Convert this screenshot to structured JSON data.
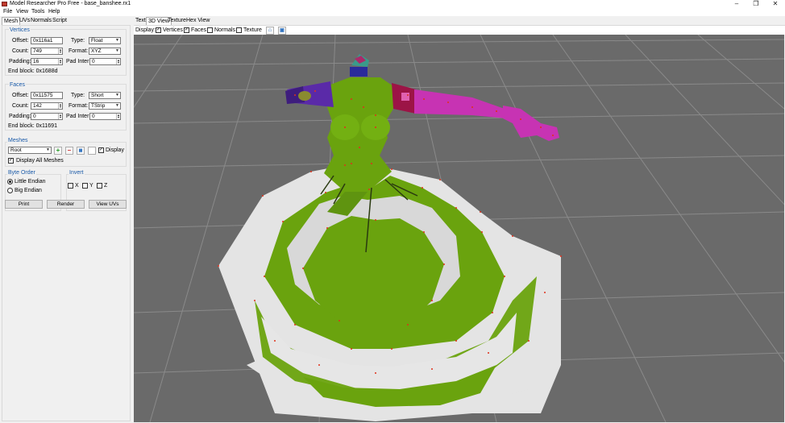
{
  "window": {
    "title": "Model Researcher Pro Free - base_banshee.rx1"
  },
  "menu": [
    "File",
    "View",
    "Tools",
    "Help"
  ],
  "left_tabs": [
    "Mesh",
    "UVs",
    "Normals",
    "Script"
  ],
  "vertices": {
    "title": "Vertices",
    "offset_label": "Offset:",
    "offset": "0x116a1",
    "type_label": "Type:",
    "type": "Float",
    "count_label": "Count:",
    "count": "749",
    "format_label": "Format:",
    "format": "XYZ",
    "padding_label": "Padding:",
    "padding": "16",
    "padinter_label": "Pad Inter:",
    "padinter": "0",
    "endblock": "End block: 0x1688d"
  },
  "faces": {
    "title": "Faces",
    "offset_label": "Offset:",
    "offset": "0x11575",
    "type_label": "Type:",
    "type": "Short",
    "count_label": "Count:",
    "count": "142",
    "format_label": "Format:",
    "format": "TStrip",
    "padding_label": "Padding:",
    "padding": "0",
    "padinter_label": "Pad Inter:",
    "padinter": "0",
    "endblock": "End block: 0x11691"
  },
  "meshes": {
    "title": "Meshes",
    "selected": "Root",
    "display_label": "Display",
    "display_all_label": "Display All Meshes"
  },
  "byte_order": {
    "title": "Byte Order",
    "little": "Little Endian",
    "big": "Big Endian"
  },
  "invert": {
    "title": "Invert",
    "x": "X",
    "y": "Y",
    "z": "Z"
  },
  "buttons": {
    "print": "Print",
    "render": "Render",
    "view_uvs": "View UVs"
  },
  "view_tabs": [
    "Text",
    "3D View",
    "Texture",
    "Hex View"
  ],
  "display": {
    "label": "Display:",
    "vertices": "Vertices",
    "faces": "Faces",
    "normals": "Normals",
    "texture": "Texture"
  },
  "colors": {
    "green": "#6aa30e",
    "white": "#e2e2e2",
    "purple": "#5a2aa8",
    "crimson": "#9c1446",
    "magenta": "#c733b3",
    "vertex": "#e0301a",
    "grid": "#8a8a8a",
    "group_title": "#1a5aa8"
  },
  "icons": [
    "app-icon",
    "minimize-icon",
    "maximize-icon",
    "close-icon",
    "add-mesh-icon",
    "remove-mesh-icon",
    "mesh-settings-icon",
    "home-view-icon",
    "reset-view-icon"
  ]
}
